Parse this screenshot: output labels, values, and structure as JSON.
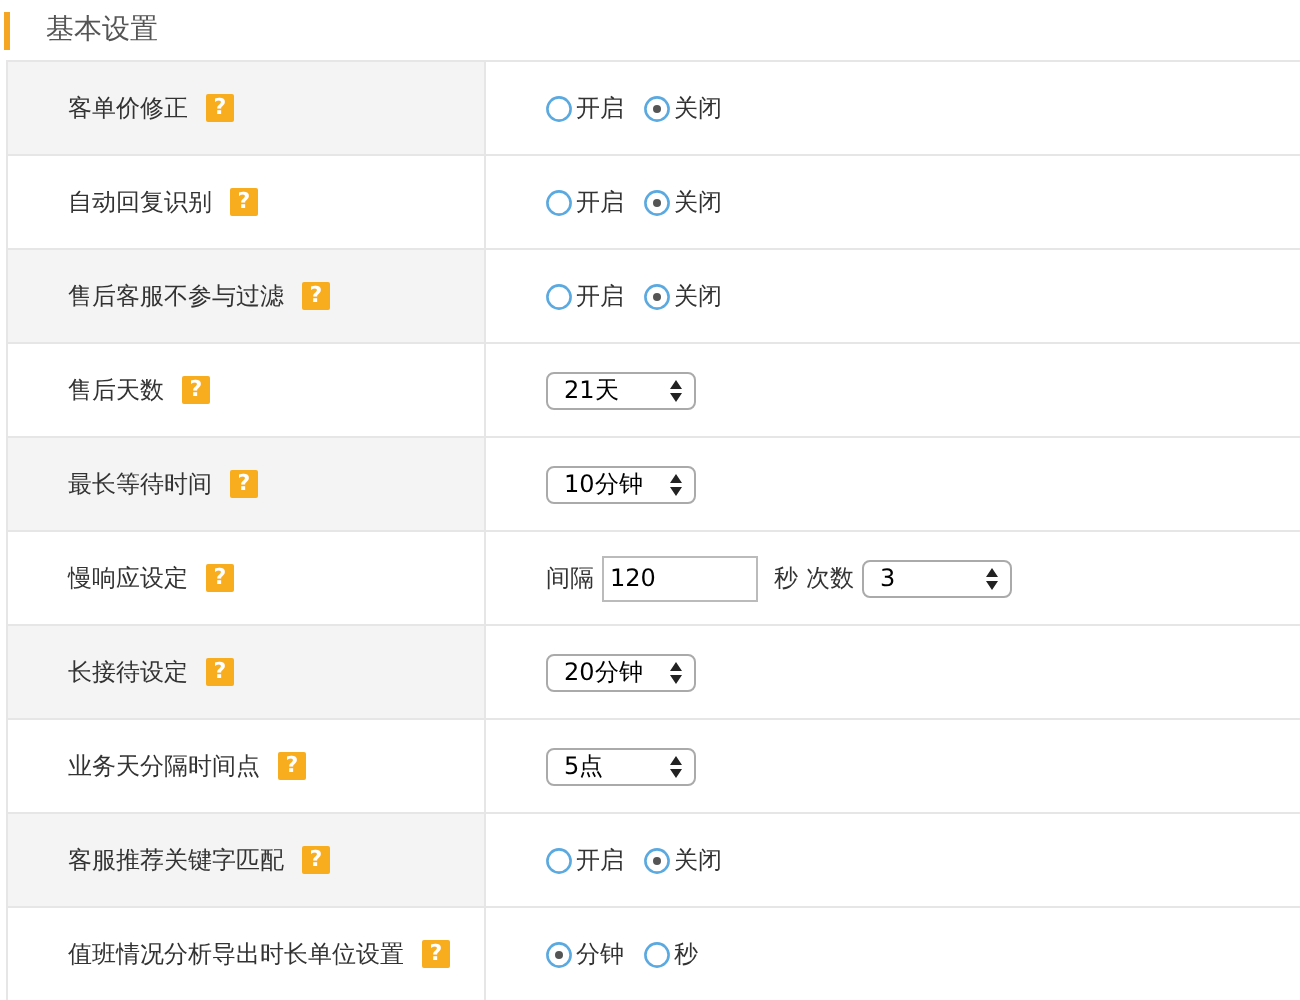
{
  "section_title": "基本设置",
  "rows": [
    {
      "label": "客单价修正",
      "help": "?",
      "kind": "radio",
      "options": [
        {
          "label": "开启",
          "selected": false
        },
        {
          "label": "关闭",
          "selected": true
        }
      ]
    },
    {
      "label": "自动回复识别",
      "help": "?",
      "kind": "radio",
      "options": [
        {
          "label": "开启",
          "selected": false
        },
        {
          "label": "关闭",
          "selected": true
        }
      ]
    },
    {
      "label": "售后客服不参与过滤",
      "help": "?",
      "kind": "radio",
      "options": [
        {
          "label": "开启",
          "selected": false
        },
        {
          "label": "关闭",
          "selected": true
        }
      ]
    },
    {
      "label": "售后天数",
      "help": "?",
      "kind": "select",
      "value": "21天"
    },
    {
      "label": "最长等待时间",
      "help": "?",
      "kind": "select",
      "value": "10分钟"
    },
    {
      "label": "慢响应设定",
      "help": "?",
      "kind": "interval",
      "interval_label": "间隔",
      "interval_value": "120",
      "unit": "秒",
      "count_label": "次数",
      "count_value": "3"
    },
    {
      "label": "长接待设定",
      "help": "?",
      "kind": "select",
      "value": "20分钟"
    },
    {
      "label": "业务天分隔时间点",
      "help": "?",
      "kind": "select",
      "value": "5点"
    },
    {
      "label": "客服推荐关键字匹配",
      "help": "?",
      "kind": "radio",
      "options": [
        {
          "label": "开启",
          "selected": false
        },
        {
          "label": "关闭",
          "selected": true
        }
      ]
    },
    {
      "label": "值班情况分析导出时长单位设置",
      "help": "?",
      "kind": "radio",
      "options": [
        {
          "label": "分钟",
          "selected": true
        },
        {
          "label": "秒",
          "selected": false
        }
      ]
    }
  ]
}
